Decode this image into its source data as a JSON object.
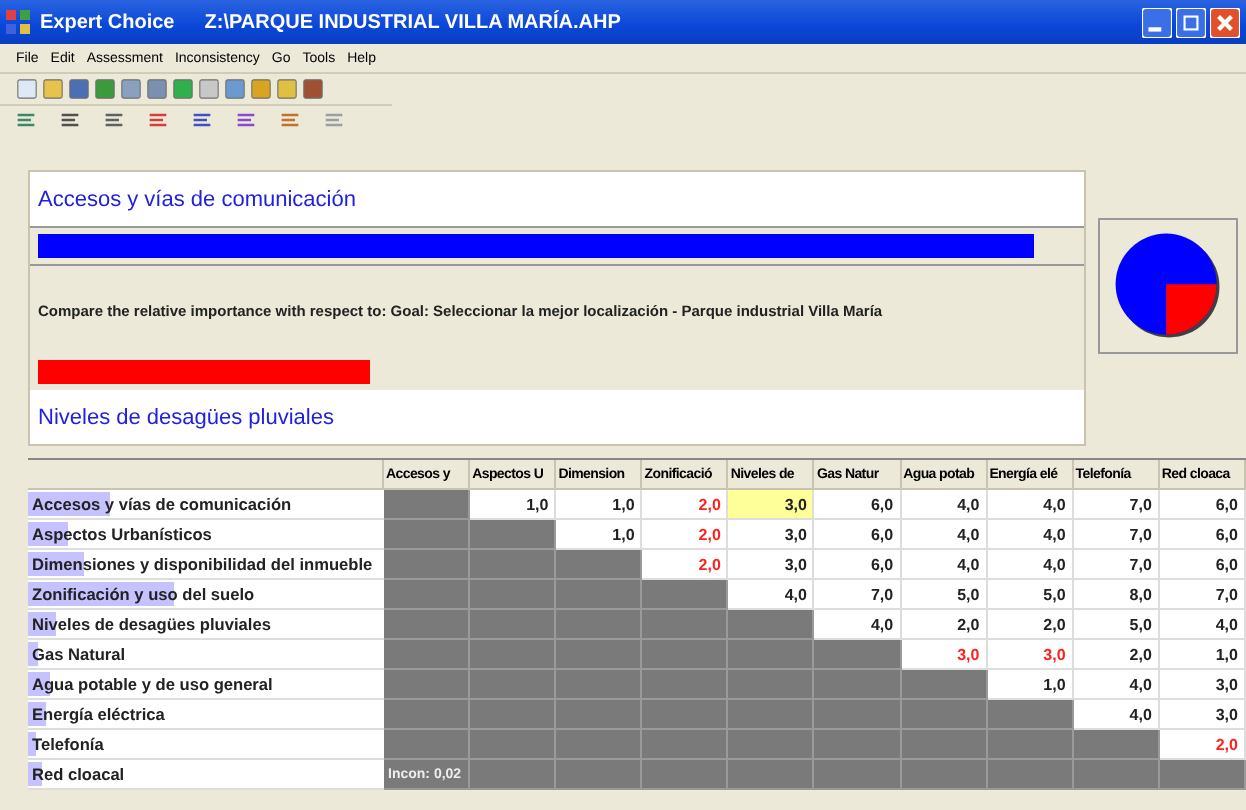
{
  "window": {
    "app": "Expert Choice",
    "file": "Z:\\PARQUE INDUSTRIAL VILLA MARÍA.AHP"
  },
  "menu": [
    "File",
    "Edit",
    "Assessment",
    "Inconsistency",
    "Go",
    "Tools",
    "Help"
  ],
  "comparison": {
    "top": {
      "label": "Accesos y vías de comunicación",
      "level": 0.96
    },
    "prompt": "Compare the relative importance with respect to: Goal: Seleccionar la mejor localización - Parque industrial Villa María",
    "bottom": {
      "label": "Niveles de desagües pluviales",
      "level": 0.32
    }
  },
  "matrix": {
    "columns": [
      "Accesos y",
      "Aspectos U",
      "Dimension",
      "Zonificació",
      "Niveles de",
      "Gas Natur",
      "Agua potab",
      "Energía elé",
      "Telefonía",
      "Red cloaca"
    ],
    "rows": [
      {
        "label": "Accesos y vías de comunicación",
        "level": 0.23,
        "cells": [
          {
            "kind": "blank"
          },
          {
            "kind": "value",
            "text": "1,0",
            "inverse": false,
            "selected": false
          },
          {
            "kind": "value",
            "text": "1,0",
            "inverse": false,
            "selected": false
          },
          {
            "kind": "value",
            "text": "2,0",
            "inverse": true,
            "selected": false
          },
          {
            "kind": "value",
            "text": "3,0",
            "inverse": false,
            "selected": true
          },
          {
            "kind": "value",
            "text": "6,0",
            "inverse": false,
            "selected": false
          },
          {
            "kind": "value",
            "text": "4,0",
            "inverse": false,
            "selected": false
          },
          {
            "kind": "value",
            "text": "4,0",
            "inverse": false,
            "selected": false
          },
          {
            "kind": "value",
            "text": "7,0",
            "inverse": false,
            "selected": false
          },
          {
            "kind": "value",
            "text": "6,0",
            "inverse": false,
            "selected": false
          }
        ]
      },
      {
        "label": "Aspectos Urbanísticos",
        "level": 0.11,
        "cells": [
          {
            "kind": "blank"
          },
          {
            "kind": "blank"
          },
          {
            "kind": "value",
            "text": "1,0",
            "inverse": false,
            "selected": false
          },
          {
            "kind": "value",
            "text": "2,0",
            "inverse": true,
            "selected": false
          },
          {
            "kind": "value",
            "text": "3,0",
            "inverse": false,
            "selected": false
          },
          {
            "kind": "value",
            "text": "6,0",
            "inverse": false,
            "selected": false
          },
          {
            "kind": "value",
            "text": "4,0",
            "inverse": false,
            "selected": false
          },
          {
            "kind": "value",
            "text": "4,0",
            "inverse": false,
            "selected": false
          },
          {
            "kind": "value",
            "text": "7,0",
            "inverse": false,
            "selected": false
          },
          {
            "kind": "value",
            "text": "6,0",
            "inverse": false,
            "selected": false
          }
        ]
      },
      {
        "label": "Dimensiones y disponibilidad del inmueble",
        "level": 0.16,
        "cells": [
          {
            "kind": "blank"
          },
          {
            "kind": "blank"
          },
          {
            "kind": "blank"
          },
          {
            "kind": "value",
            "text": "2,0",
            "inverse": true,
            "selected": false
          },
          {
            "kind": "value",
            "text": "3,0",
            "inverse": false,
            "selected": false
          },
          {
            "kind": "value",
            "text": "6,0",
            "inverse": false,
            "selected": false
          },
          {
            "kind": "value",
            "text": "4,0",
            "inverse": false,
            "selected": false
          },
          {
            "kind": "value",
            "text": "4,0",
            "inverse": false,
            "selected": false
          },
          {
            "kind": "value",
            "text": "7,0",
            "inverse": false,
            "selected": false
          },
          {
            "kind": "value",
            "text": "6,0",
            "inverse": false,
            "selected": false
          }
        ]
      },
      {
        "label": "Zonificación y uso del suelo",
        "level": 0.41,
        "cells": [
          {
            "kind": "blank"
          },
          {
            "kind": "blank"
          },
          {
            "kind": "blank"
          },
          {
            "kind": "blank"
          },
          {
            "kind": "value",
            "text": "4,0",
            "inverse": false,
            "selected": false
          },
          {
            "kind": "value",
            "text": "7,0",
            "inverse": false,
            "selected": false
          },
          {
            "kind": "value",
            "text": "5,0",
            "inverse": false,
            "selected": false
          },
          {
            "kind": "value",
            "text": "5,0",
            "inverse": false,
            "selected": false
          },
          {
            "kind": "value",
            "text": "8,0",
            "inverse": false,
            "selected": false
          },
          {
            "kind": "value",
            "text": "7,0",
            "inverse": false,
            "selected": false
          }
        ]
      },
      {
        "label": "Niveles de desagües pluviales",
        "level": 0.08,
        "cells": [
          {
            "kind": "blank"
          },
          {
            "kind": "blank"
          },
          {
            "kind": "blank"
          },
          {
            "kind": "blank"
          },
          {
            "kind": "blank"
          },
          {
            "kind": "value",
            "text": "4,0",
            "inverse": false,
            "selected": false
          },
          {
            "kind": "value",
            "text": "2,0",
            "inverse": false,
            "selected": false
          },
          {
            "kind": "value",
            "text": "2,0",
            "inverse": false,
            "selected": false
          },
          {
            "kind": "value",
            "text": "5,0",
            "inverse": false,
            "selected": false
          },
          {
            "kind": "value",
            "text": "4,0",
            "inverse": false,
            "selected": false
          }
        ]
      },
      {
        "label": "Gas Natural",
        "level": 0.03,
        "cells": [
          {
            "kind": "blank"
          },
          {
            "kind": "blank"
          },
          {
            "kind": "blank"
          },
          {
            "kind": "blank"
          },
          {
            "kind": "blank"
          },
          {
            "kind": "blank"
          },
          {
            "kind": "value",
            "text": "3,0",
            "inverse": true,
            "selected": false
          },
          {
            "kind": "value",
            "text": "3,0",
            "inverse": true,
            "selected": false
          },
          {
            "kind": "value",
            "text": "2,0",
            "inverse": false,
            "selected": false
          },
          {
            "kind": "value",
            "text": "1,0",
            "inverse": false,
            "selected": false
          }
        ]
      },
      {
        "label": "Agua potable y de uso general",
        "level": 0.06,
        "cells": [
          {
            "kind": "blank"
          },
          {
            "kind": "blank"
          },
          {
            "kind": "blank"
          },
          {
            "kind": "blank"
          },
          {
            "kind": "blank"
          },
          {
            "kind": "blank"
          },
          {
            "kind": "blank"
          },
          {
            "kind": "value",
            "text": "1,0",
            "inverse": false,
            "selected": false
          },
          {
            "kind": "value",
            "text": "4,0",
            "inverse": false,
            "selected": false
          },
          {
            "kind": "value",
            "text": "3,0",
            "inverse": false,
            "selected": false
          }
        ]
      },
      {
        "label": "Energía eléctrica",
        "level": 0.05,
        "cells": [
          {
            "kind": "blank"
          },
          {
            "kind": "blank"
          },
          {
            "kind": "blank"
          },
          {
            "kind": "blank"
          },
          {
            "kind": "blank"
          },
          {
            "kind": "blank"
          },
          {
            "kind": "blank"
          },
          {
            "kind": "blank"
          },
          {
            "kind": "value",
            "text": "4,0",
            "inverse": false,
            "selected": false
          },
          {
            "kind": "value",
            "text": "3,0",
            "inverse": false,
            "selected": false
          }
        ]
      },
      {
        "label": "Telefonía",
        "level": 0.02,
        "cells": [
          {
            "kind": "blank"
          },
          {
            "kind": "blank"
          },
          {
            "kind": "blank"
          },
          {
            "kind": "blank"
          },
          {
            "kind": "blank"
          },
          {
            "kind": "blank"
          },
          {
            "kind": "blank"
          },
          {
            "kind": "blank"
          },
          {
            "kind": "blank"
          },
          {
            "kind": "value",
            "text": "2,0",
            "inverse": true,
            "selected": false
          }
        ]
      },
      {
        "label": "Red cloacal",
        "level": 0.04,
        "cells": [
          {
            "kind": "note",
            "text": "Incon: 0,02"
          },
          {
            "kind": "blank"
          },
          {
            "kind": "blank"
          },
          {
            "kind": "blank"
          },
          {
            "kind": "blank"
          },
          {
            "kind": "blank"
          },
          {
            "kind": "blank"
          },
          {
            "kind": "blank"
          },
          {
            "kind": "blank"
          },
          {
            "kind": "blank"
          }
        ]
      }
    ]
  }
}
